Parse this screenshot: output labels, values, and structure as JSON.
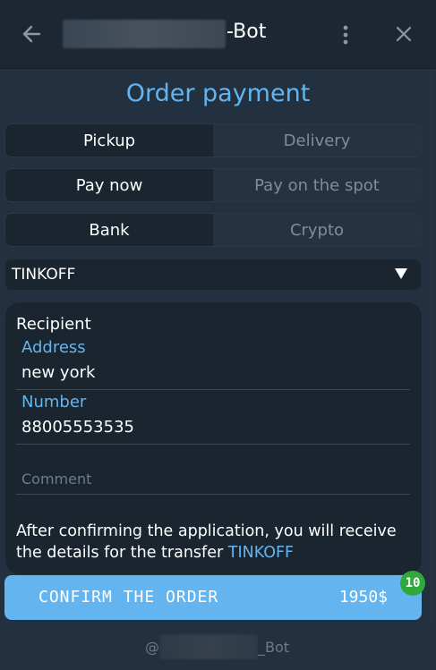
{
  "header": {
    "title_suffix": "-Bot",
    "back_icon": "back-arrow-icon",
    "menu_icon": "more-vertical-icon",
    "close_icon": "close-icon"
  },
  "page": {
    "title": "Order payment"
  },
  "delivery_toggle": {
    "options": [
      "Pickup",
      "Delivery"
    ],
    "selected": "Pickup"
  },
  "payment_time_toggle": {
    "options": [
      "Pay now",
      "Pay on the spot"
    ],
    "selected": "Pay now"
  },
  "payment_method_toggle": {
    "options": [
      "Bank",
      "Crypto"
    ],
    "selected": "Bank"
  },
  "bank_select": {
    "value": "TINKOFF",
    "arrow": "▼"
  },
  "recipient": {
    "heading": "Recipient",
    "address_label": "Address",
    "address_value": "new york",
    "number_label": "Number",
    "number_value": "88005553535",
    "comment_placeholder": "Comment"
  },
  "info": {
    "text": "After confirming the application, you will receive the details for the transfer",
    "bank_name": "TINKOFF"
  },
  "confirm": {
    "label": "CONFIRM THE ORDER",
    "price": "1950$",
    "badge_count": "10"
  },
  "footer": {
    "prefix": "@",
    "suffix": "_Bot"
  },
  "colors": {
    "accent": "#64b5ef",
    "background": "#22303f",
    "header": "#1c2733",
    "badge": "#2faa3a"
  }
}
